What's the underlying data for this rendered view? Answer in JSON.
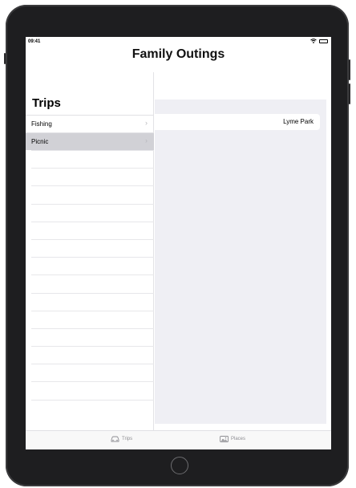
{
  "status_bar": {
    "time": "09:41"
  },
  "nav": {
    "title": "Family Outings"
  },
  "master": {
    "title": "Trips",
    "items": [
      {
        "label": "Fishing",
        "selected": false
      },
      {
        "label": "Picnic",
        "selected": true
      }
    ]
  },
  "detail": {
    "cells": [
      {
        "label": "Lyme Park"
      }
    ]
  },
  "tab_bar": {
    "tabs": [
      {
        "label": "Trips",
        "icon": "car-icon"
      },
      {
        "label": "Places",
        "icon": "photo-icon"
      }
    ]
  },
  "colors": {
    "bezel": "#1e1e20",
    "selected_row": "#d1d1d6",
    "grouped_background": "#efeff4",
    "tab_inactive": "#8e8e93"
  }
}
